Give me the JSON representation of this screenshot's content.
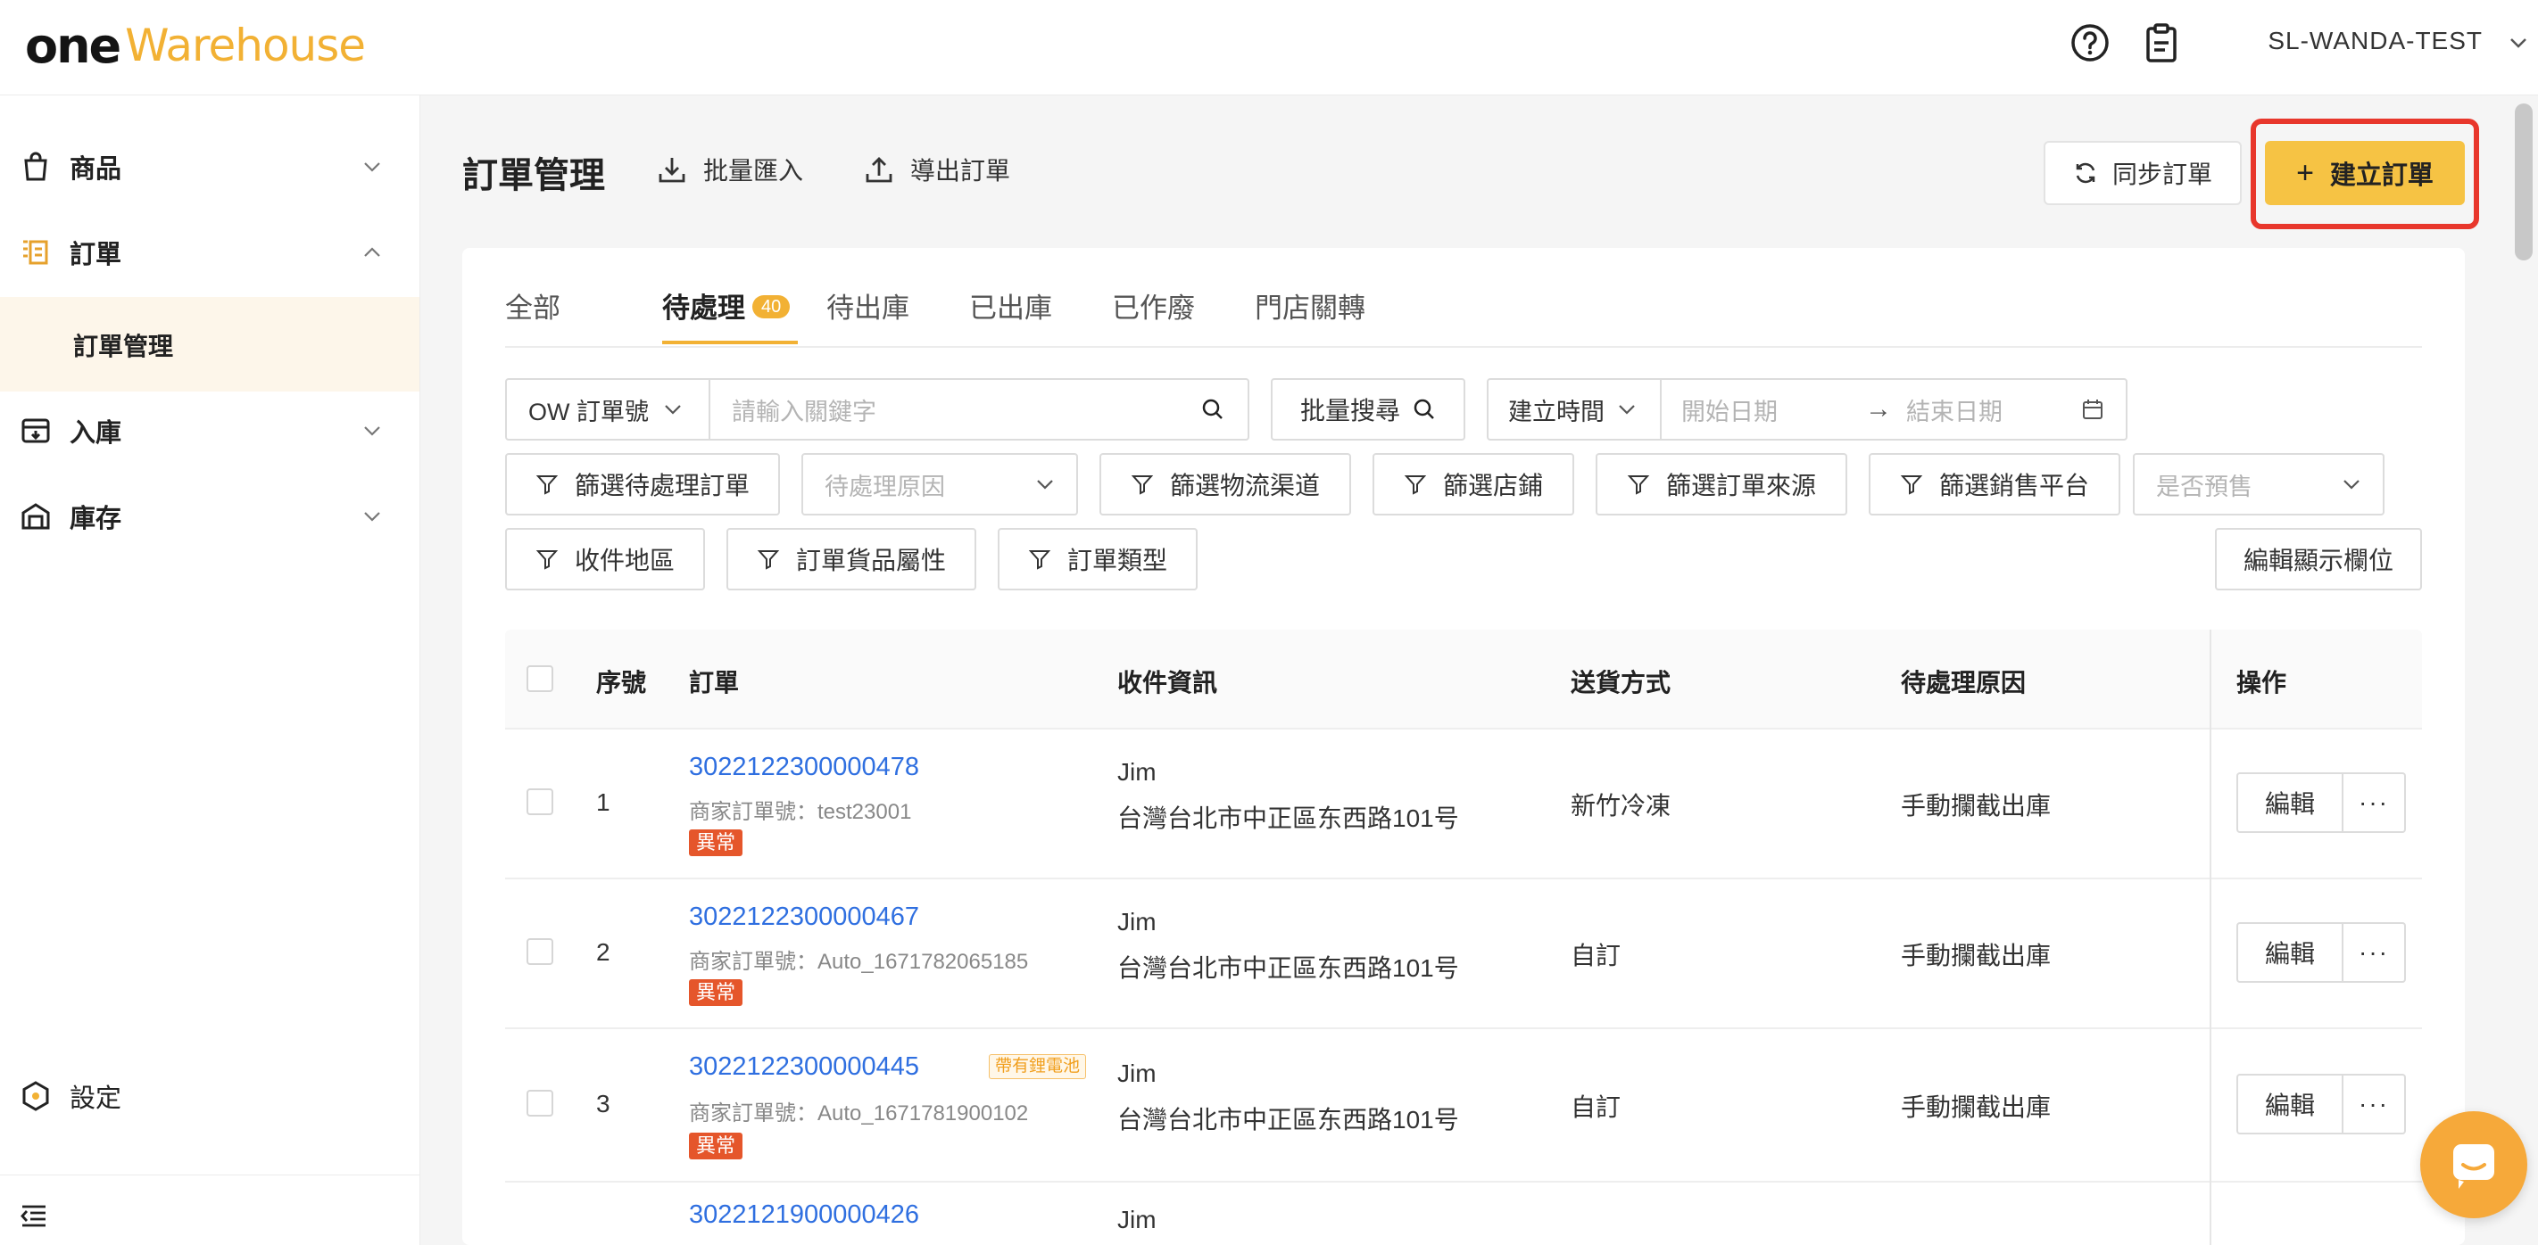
{
  "brand": {
    "one": "one",
    "warehouse": "Warehouse"
  },
  "topbar": {
    "user": "SL-WANDA-TEST",
    "icons": [
      "help-icon",
      "clipboard-icon",
      "chevron-down-icon"
    ]
  },
  "sidebar": {
    "items": [
      {
        "label": "商品",
        "icon": "shopping-bag-icon",
        "expanded": false
      },
      {
        "label": "訂單",
        "icon": "order-list-icon",
        "expanded": true
      },
      {
        "label": "入庫",
        "icon": "inbound-icon",
        "expanded": false
      },
      {
        "label": "庫存",
        "icon": "storage-icon",
        "expanded": false
      }
    ],
    "sub_item": "訂單管理",
    "settings": "設定",
    "collapse_icon": "menu-collapse-icon"
  },
  "header": {
    "title": "訂單管理",
    "import": "批量匯入",
    "export": "導出訂單",
    "sync": "同步訂單",
    "create": "建立訂單"
  },
  "tabs": [
    {
      "label": "全部"
    },
    {
      "label": "待處理",
      "count": "40",
      "active": true
    },
    {
      "label": "待出庫"
    },
    {
      "label": "已出庫"
    },
    {
      "label": "已作廢"
    },
    {
      "label": "門店關轉"
    }
  ],
  "filters": {
    "search_type": "OW 訂單號",
    "search_placeholder": "請輸入關鍵字",
    "batch_search": "批量搜尋",
    "time_type": "建立時間",
    "start_date": "開始日期",
    "end_date": "結束日期",
    "filter_pending": "篩選待處理訂單",
    "pending_reason_placeholder": "待處理原因",
    "filter_logistics": "篩選物流渠道",
    "filter_store": "篩選店鋪",
    "filter_source": "篩選訂單來源",
    "filter_platform": "篩選銷售平台",
    "presale_placeholder": "是否預售",
    "filter_region": "收件地區",
    "filter_goods": "訂單貨品屬性",
    "filter_type": "訂單類型",
    "edit_columns": "編輯顯示欄位"
  },
  "table": {
    "headers": {
      "seq": "序號",
      "order": "訂單",
      "recipient": "收件資訊",
      "shipping": "送貨方式",
      "reason": "待處理原因",
      "ops": "操作"
    },
    "merchant_prefix": "商家訂單號：",
    "edit_label": "編輯",
    "more_label": "···",
    "rows": [
      {
        "seq": "1",
        "order_no": "3022122300000478",
        "merchant_no": "test23001",
        "tag": "異常",
        "name": "Jim",
        "address": "台灣台北市中正區东西路101号",
        "shipping": "新竹冷凍",
        "reason": "手動攔截出庫"
      },
      {
        "seq": "2",
        "order_no": "3022122300000467",
        "merchant_no": "Auto_1671782065185",
        "tag": "異常",
        "name": "Jim",
        "address": "台灣台北市中正區东西路101号",
        "shipping": "自訂",
        "reason": "手動攔截出庫"
      },
      {
        "seq": "3",
        "order_no": "3022122300000445",
        "extra_tag": "帶有鋰電池",
        "merchant_no": "Auto_1671781900102",
        "tag": "異常",
        "name": "Jim",
        "address": "台灣台北市中正區东西路101号",
        "shipping": "自訂",
        "reason": "手動攔截出庫"
      },
      {
        "seq": "",
        "order_no": "3022121900000426",
        "name": "Jim"
      }
    ]
  },
  "colors": {
    "accent": "#f6c344",
    "link": "#2f6fe0",
    "danger": "#e5562b",
    "highlight_border": "#e8372c"
  }
}
